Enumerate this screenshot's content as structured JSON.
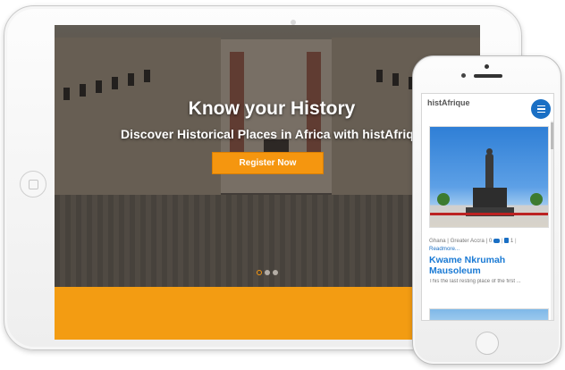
{
  "hero": {
    "title": "Know your History",
    "subtitle": "Discover Historical Places in Africa with histAfrique",
    "register_label": "Register Now",
    "slides": [
      true,
      false,
      false
    ]
  },
  "phone": {
    "brand": "histAfrique",
    "card": {
      "meta_location": "Ghana | Greater Accra | ",
      "comment_count": "0",
      "like_count": "1",
      "read_more": "Readmore...",
      "title": "Kwame Nkrumah Mausoleum",
      "description": "This the last resting place of the first ..."
    }
  },
  "colors": {
    "accent_orange": "#f39c12",
    "link_blue": "#1a7ad4",
    "menu_blue": "#1a6fc4"
  },
  "icons": {
    "menu": "hamburger-icon",
    "comment": "comment-icon",
    "like": "thumbs-up-icon"
  }
}
